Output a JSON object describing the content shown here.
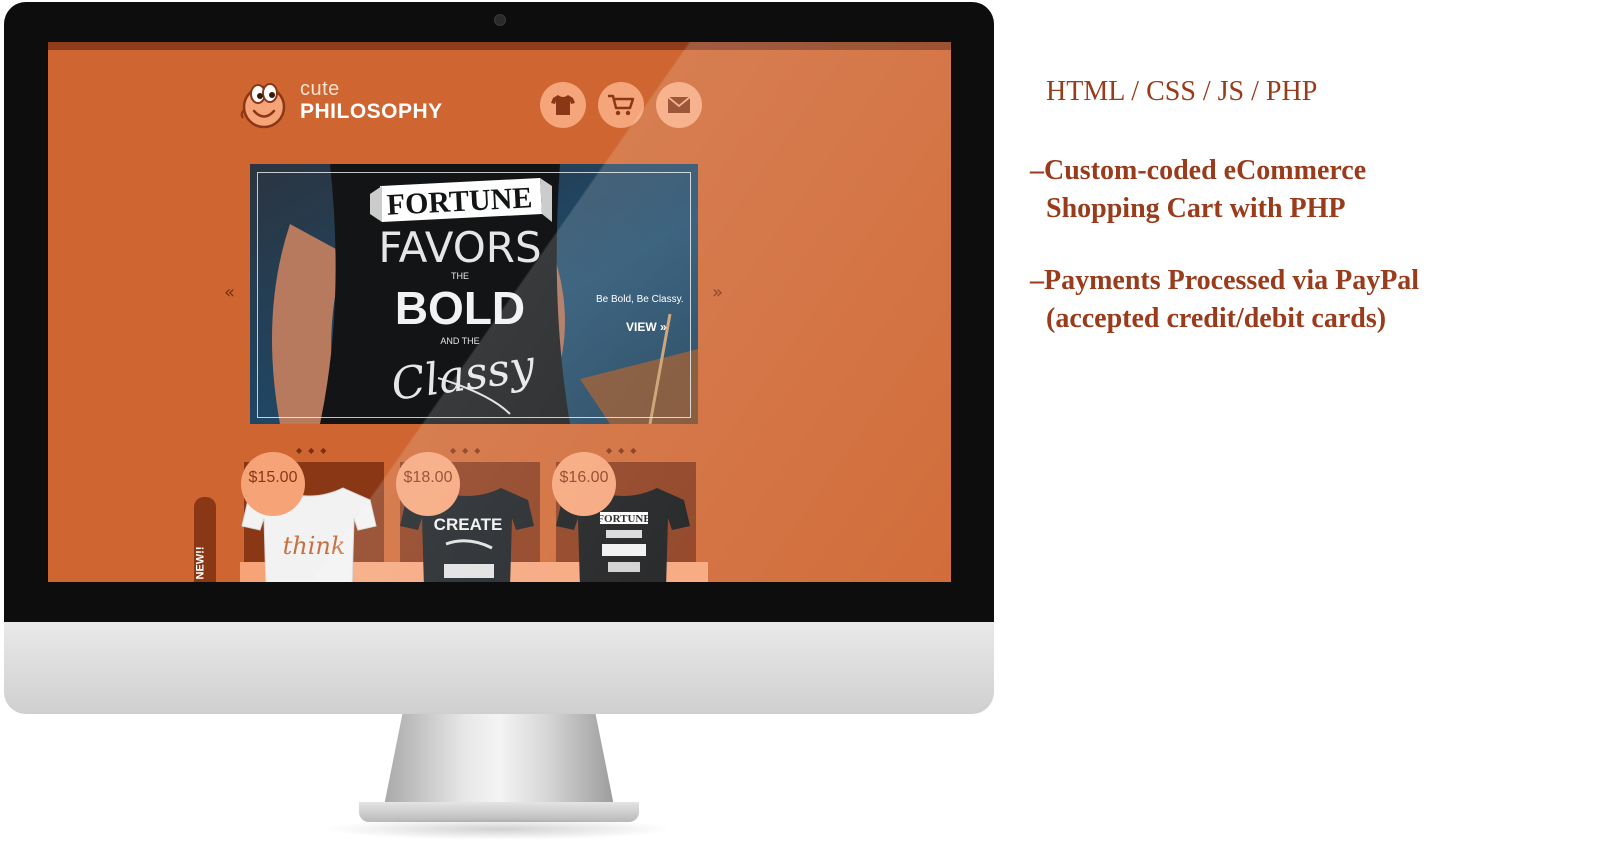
{
  "site": {
    "logo": {
      "small": "cute",
      "large": "PHILOSOPHY"
    },
    "nav_icons": [
      "tshirt-icon",
      "cart-icon",
      "mail-icon"
    ],
    "slider": {
      "shirt_lines": [
        "FORTUNE",
        "FAVORS",
        "THE",
        "BOLD",
        "AND THE",
        "Classy"
      ],
      "caption": "Be Bold, Be Classy.",
      "view_label": "VIEW »",
      "prev_arrow": "«",
      "next_arrow": "»"
    },
    "products": [
      {
        "price": "$15.00",
        "shirt_text": "think"
      },
      {
        "price": "$18.00",
        "shirt_text": "CREATE"
      },
      {
        "price": "$16.00",
        "shirt_text": "FORTUNE"
      }
    ],
    "new_tag": "NEW!!",
    "colors": {
      "accent": "#cf6530",
      "dark": "#8a3716",
      "light": "#f6a377"
    }
  },
  "description": {
    "title": "HTML / CSS / JS / PHP",
    "items": [
      {
        "line1": "–Custom-coded eCommerce",
        "line2": "Shopping Cart with PHP"
      },
      {
        "line1": "–Payments Processed via PayPal",
        "line2": "(accepted credit/debit cards)"
      }
    ]
  }
}
